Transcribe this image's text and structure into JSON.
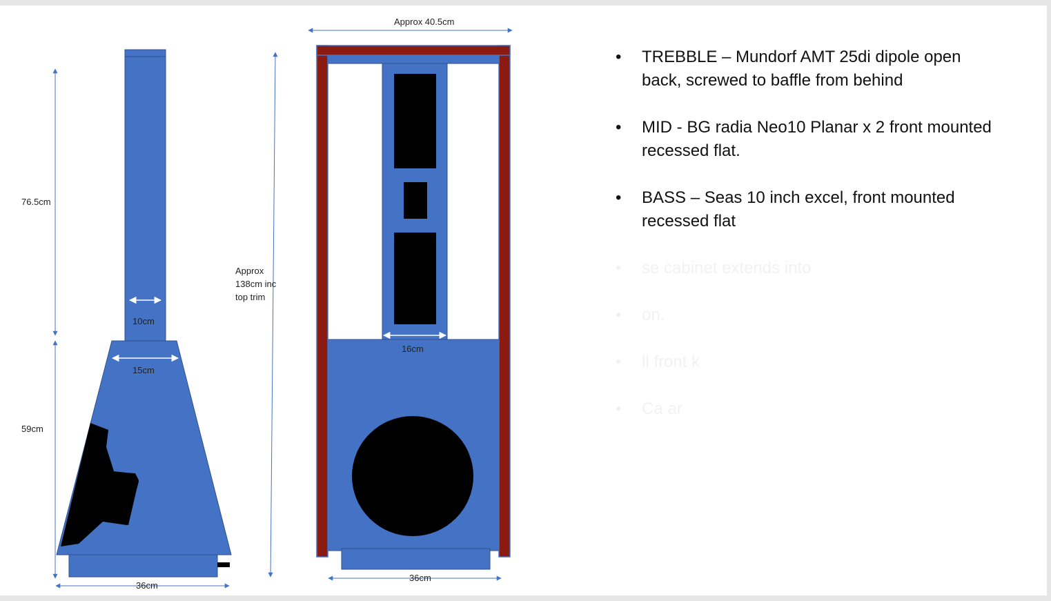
{
  "labels": {
    "side_top_height": "76.5cm",
    "side_bottom_height": "59cm",
    "side_top_width": "10cm",
    "side_mid_width": "15cm",
    "side_base_width": "36cm",
    "total_height": "Approx\n138cm inc\ntop trim",
    "front_width": "Approx 40.5cm",
    "front_mid_width": "16cm",
    "front_base_width": "36cm"
  },
  "bullets": [
    "TREBBLE – Mundorf AMT 25di dipole open back, screwed to baffle from behind",
    "MID -  BG radia Neo10 Planar x 2 front mounted recessed flat.",
    "BASS – Seas 10 inch excel, front mounted recessed flat"
  ],
  "faint_bullets": [
    "se   cabinet extends into",
    "on.",
    "ll front   k",
    "Ca   ar"
  ],
  "colors": {
    "cabinet_blue": "#4472c4",
    "trim_red": "#8b1a10",
    "driver_black": "#000000",
    "dimension_line": "#4472c4"
  }
}
